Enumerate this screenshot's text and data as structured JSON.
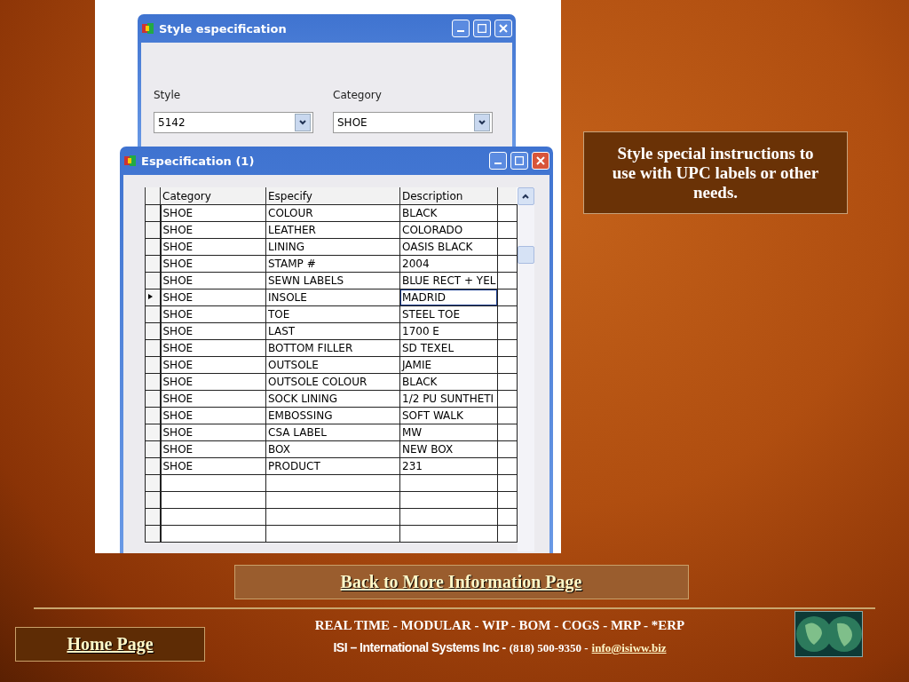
{
  "style_window": {
    "title": "Style especification",
    "fields": [
      {
        "label": "Style",
        "value": "5142"
      },
      {
        "label": "Category",
        "value": "SHOE"
      }
    ]
  },
  "spec_window": {
    "title": "Especification (1)",
    "columns": [
      "Category",
      "Especify",
      "Description"
    ],
    "rows": [
      {
        "cells": [
          "SHOE",
          "COLOUR",
          "BLACK"
        ],
        "selected": false
      },
      {
        "cells": [
          "SHOE",
          "LEATHER",
          "COLORADO"
        ],
        "selected": false
      },
      {
        "cells": [
          "SHOE",
          "LINING",
          "OASIS  BLACK"
        ],
        "selected": false
      },
      {
        "cells": [
          "SHOE",
          "STAMP #",
          "2004"
        ],
        "selected": false
      },
      {
        "cells": [
          "SHOE",
          "SEWN LABELS",
          "BLUE RECT + YEL"
        ],
        "selected": false
      },
      {
        "cells": [
          "SHOE",
          "INSOLE",
          "MADRID"
        ],
        "selected": true
      },
      {
        "cells": [
          "SHOE",
          "TOE",
          "STEEL TOE"
        ],
        "selected": false
      },
      {
        "cells": [
          "SHOE",
          "LAST",
          "1700    E"
        ],
        "selected": false
      },
      {
        "cells": [
          "SHOE",
          "BOTTOM FILLER",
          "SD TEXEL"
        ],
        "selected": false
      },
      {
        "cells": [
          "SHOE",
          "OUTSOLE",
          "JAMIE"
        ],
        "selected": false
      },
      {
        "cells": [
          "SHOE",
          "OUTSOLE COLOUR",
          "BLACK"
        ],
        "selected": false
      },
      {
        "cells": [
          "SHOE",
          "SOCK LINING",
          "1/2 PU SUNTHETI"
        ],
        "selected": false
      },
      {
        "cells": [
          "SHOE",
          "EMBOSSING",
          "SOFT WALK"
        ],
        "selected": false
      },
      {
        "cells": [
          "SHOE",
          "CSA LABEL",
          "MW"
        ],
        "selected": false
      },
      {
        "cells": [
          "SHOE",
          "BOX",
          "NEW BOX"
        ],
        "selected": false
      },
      {
        "cells": [
          "SHOE",
          "PRODUCT",
          "231"
        ],
        "selected": false
      }
    ]
  },
  "note": "Style special instructions to use with UPC labels or other needs.",
  "back_link": "Back to More Information Page",
  "footer": {
    "home_link": "Home Page",
    "tagline": "REAL TIME - MODULAR - WIP - BOM - COGS - MRP - *ERP",
    "company": "ISI – International Systems Inc -",
    "phone": "(818) 500-9350 -",
    "email": "info@isiww.biz"
  }
}
